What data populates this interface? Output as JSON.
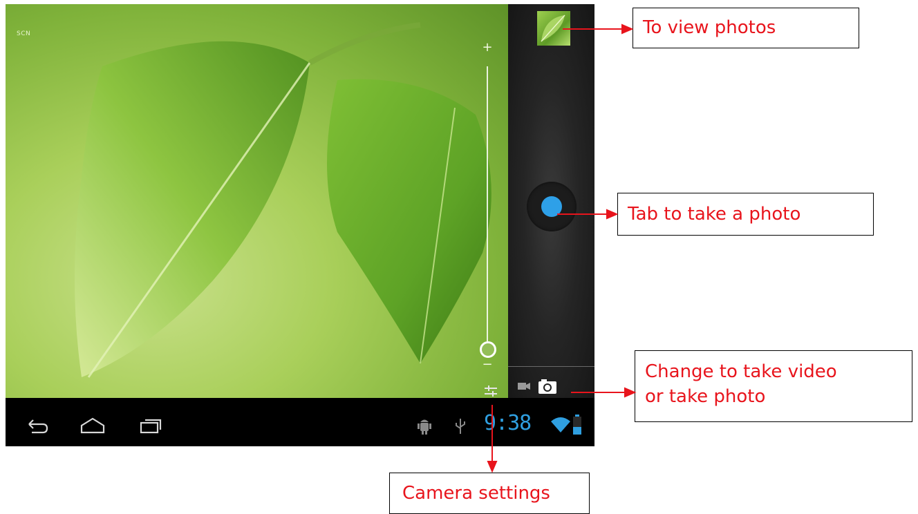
{
  "viewfinder": {
    "scene_label": "SCN",
    "zoom_plus": "+",
    "zoom_minus": "−"
  },
  "side_panel": {
    "thumbnail_icon": "leaf-photo-thumbnail",
    "shutter_icon": "shutter-button",
    "mode_icons": [
      "video-camera-icon",
      "photo-camera-icon"
    ],
    "shutter_color": "#2ea0e8"
  },
  "navbar": {
    "buttons": [
      "back-icon",
      "home-icon",
      "recent-apps-icon"
    ],
    "status_icons": [
      "android-debug-icon",
      "usb-icon",
      "wifi-icon",
      "battery-icon"
    ],
    "clock": "9:38",
    "clock_color": "#2f9fe0"
  },
  "annotations": {
    "view_photos": "To view photos",
    "take_photo": "Tab to take a photo",
    "mode_line1": "Change to take video",
    "mode_line2": "or take photo",
    "camera_settings": "Camera settings",
    "arrow_color": "#e8141c"
  }
}
